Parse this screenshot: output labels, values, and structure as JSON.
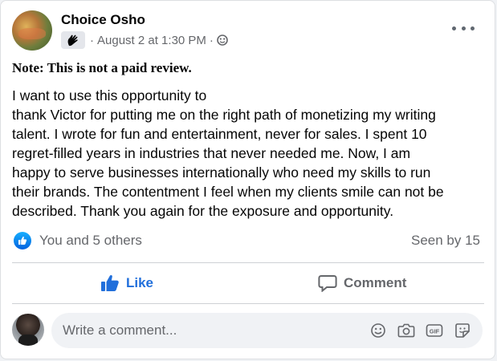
{
  "post": {
    "author": "Choice Osho",
    "timestamp": "August 2 at 1:30 PM",
    "meta_separator_1": "·",
    "meta_separator_2": "·",
    "note": "Note: This is not a paid review.",
    "body_lines": [
      "I want to use this opportunity to",
      "thank Victor for putting me on the right path of monetizing my writing",
      "talent. I wrote for fun and entertainment, never for sales. I spent 10",
      "regret-filled years in industries that never needed me. Now, I am",
      "happy to serve businesses internationally who need my skills to run",
      "their brands. The contentment I feel when my clients smile can not be",
      "described. Thank you again for the exposure and opportunity."
    ]
  },
  "reactions": {
    "summary": "You and 5 others",
    "seen_by": "Seen by 15"
  },
  "actions": {
    "like_label": "Like",
    "comment_label": "Comment",
    "like_color": "#216fdb"
  },
  "composer": {
    "placeholder": "Write a comment...",
    "icons": [
      "emoji-icon",
      "camera-icon",
      "gif-icon",
      "sticker-icon"
    ]
  },
  "colors": {
    "secondary_text": "#65676b",
    "accent_blue": "#0062df"
  }
}
